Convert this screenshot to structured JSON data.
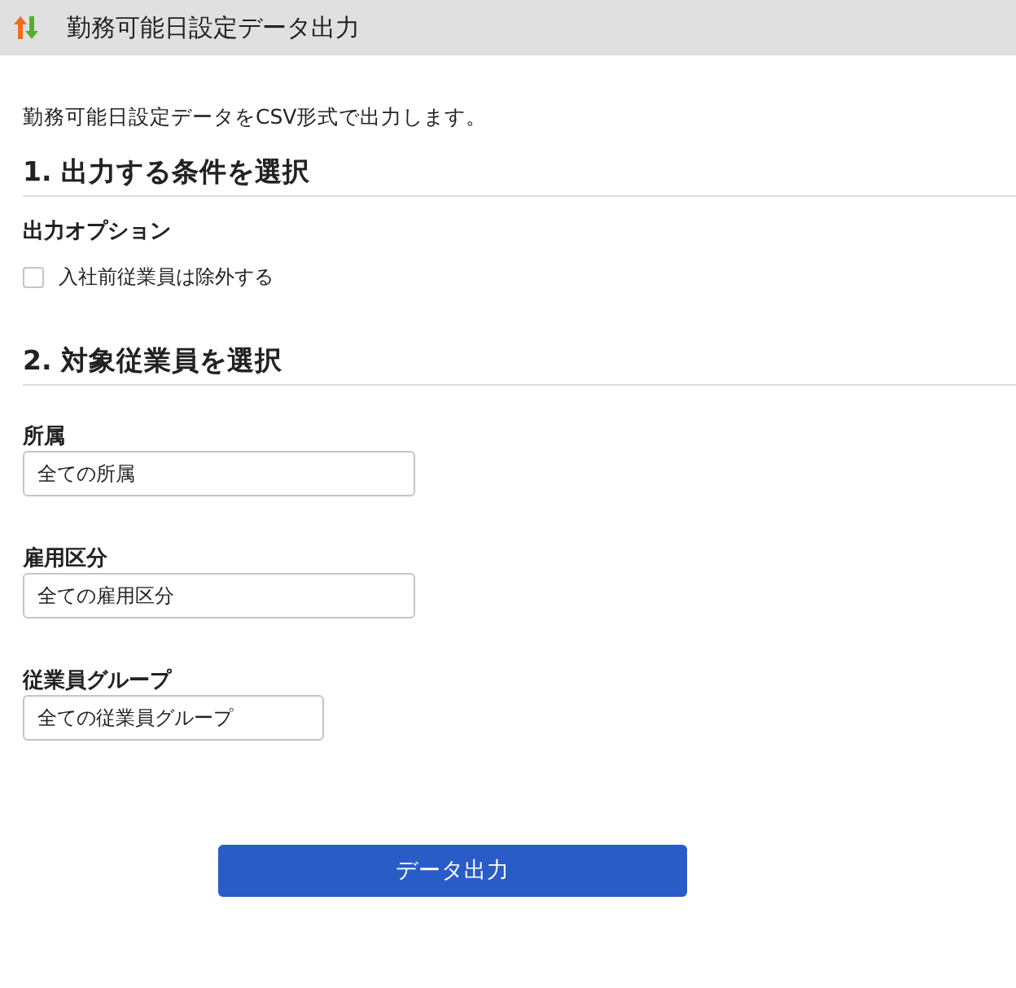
{
  "header": {
    "title": "勤務可能日設定データ出力"
  },
  "description": "勤務可能日設定データをCSV形式で出力します。",
  "sections": [
    {
      "heading": "1. 出力する条件を選択",
      "items": [
        {
          "kind": "subheading",
          "text": "出力オプション"
        },
        {
          "kind": "checkbox",
          "label": "入社前従業員は除外する",
          "checked": false
        }
      ]
    },
    {
      "heading": "2. 対象従業員を選択",
      "items": [
        {
          "kind": "field",
          "label": "所属",
          "value": "全ての所属"
        },
        {
          "kind": "field",
          "label": "雇用区分",
          "value": "全ての雇用区分"
        },
        {
          "kind": "field",
          "label": "従業員グループ",
          "value": "全ての従業員グループ"
        }
      ]
    }
  ],
  "button": {
    "label": "データ出力"
  }
}
